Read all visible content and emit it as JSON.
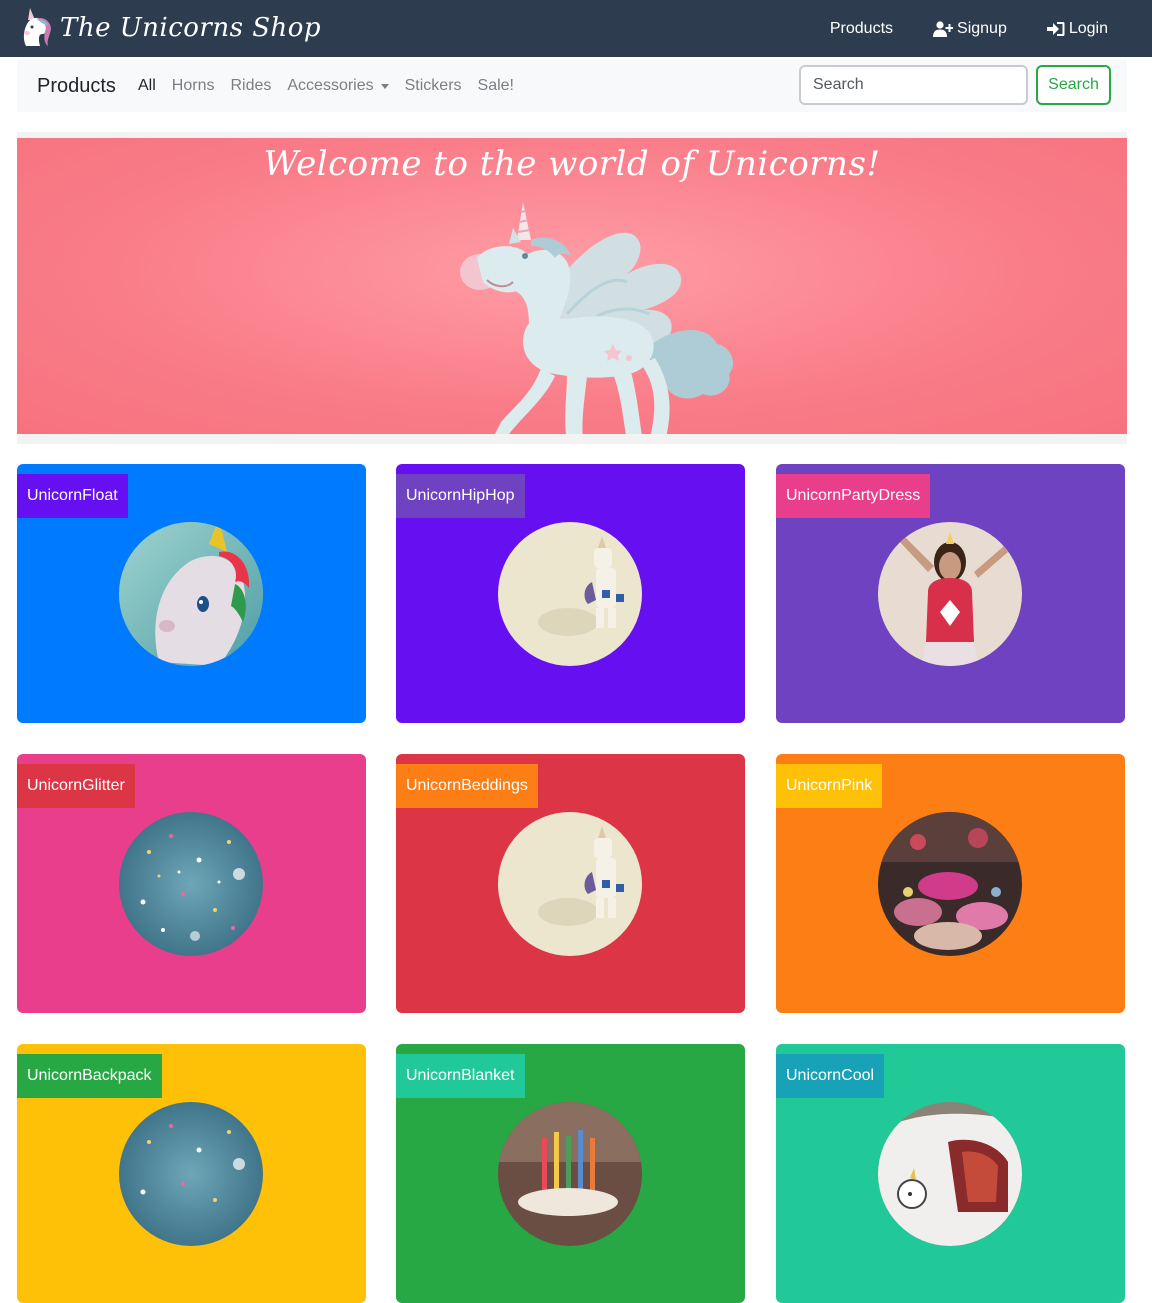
{
  "brand": {
    "name": "The Unicorns Shop",
    "logo_icon": "unicorn-head-icon"
  },
  "topnav": {
    "products_label": "Products",
    "signup_label": "Signup",
    "login_label": "Login",
    "signup_icon": "user-plus-icon",
    "login_icon": "sign-in-icon"
  },
  "products_nav": {
    "title": "Products",
    "links": {
      "all": "All",
      "horns": "Horns",
      "rides": "Rides",
      "accessories": "Accessories",
      "stickers": "Stickers",
      "sale": "Sale!"
    },
    "search_placeholder": "Search",
    "search_button": "Search"
  },
  "hero": {
    "title": "Welcome to the world of Unicorns!"
  },
  "colors": {
    "topbar": "#2d3c4f",
    "blue": "#007bff",
    "indigo": "#6610f2",
    "purple": "#6f42c1",
    "pink": "#e83e8c",
    "red": "#dc3545",
    "orange": "#fd7e14",
    "yellow": "#ffc107",
    "green": "#28a745",
    "teal": "#20c997",
    "cyan": "#17a2b8"
  },
  "products": [
    {
      "name": "UnicornFloat",
      "bg": "#007bff",
      "label_bg": "#6610f2",
      "image": "pool-float-unicorn"
    },
    {
      "name": "UnicornHipHop",
      "bg": "#6610f2",
      "label_bg": "#6f42c1",
      "image": "toy-unicorn-figure"
    },
    {
      "name": "UnicornPartyDress",
      "bg": "#6f42c1",
      "label_bg": "#e83e8c",
      "image": "girl-unicorn-headband"
    },
    {
      "name": "UnicornGlitter",
      "bg": "#e83e8c",
      "label_bg": "#dc3545",
      "image": "glitter-confetti"
    },
    {
      "name": "UnicornBeddings",
      "bg": "#dc3545",
      "label_bg": "#fd7e14",
      "image": "toy-unicorn-figure"
    },
    {
      "name": "UnicornPink",
      "bg": "#fd7e14",
      "label_bg": "#ffc107",
      "image": "market-plush-toys"
    },
    {
      "name": "UnicornBackpack",
      "bg": "#ffc107",
      "label_bg": "#28a745",
      "image": "glitter-confetti"
    },
    {
      "name": "UnicornBlanket",
      "bg": "#28a745",
      "label_bg": "#20c997",
      "image": "birthday-candles"
    },
    {
      "name": "UnicornCool",
      "bg": "#20c997",
      "label_bg": "#17a2b8",
      "image": "car-unicorn-sticker"
    }
  ]
}
